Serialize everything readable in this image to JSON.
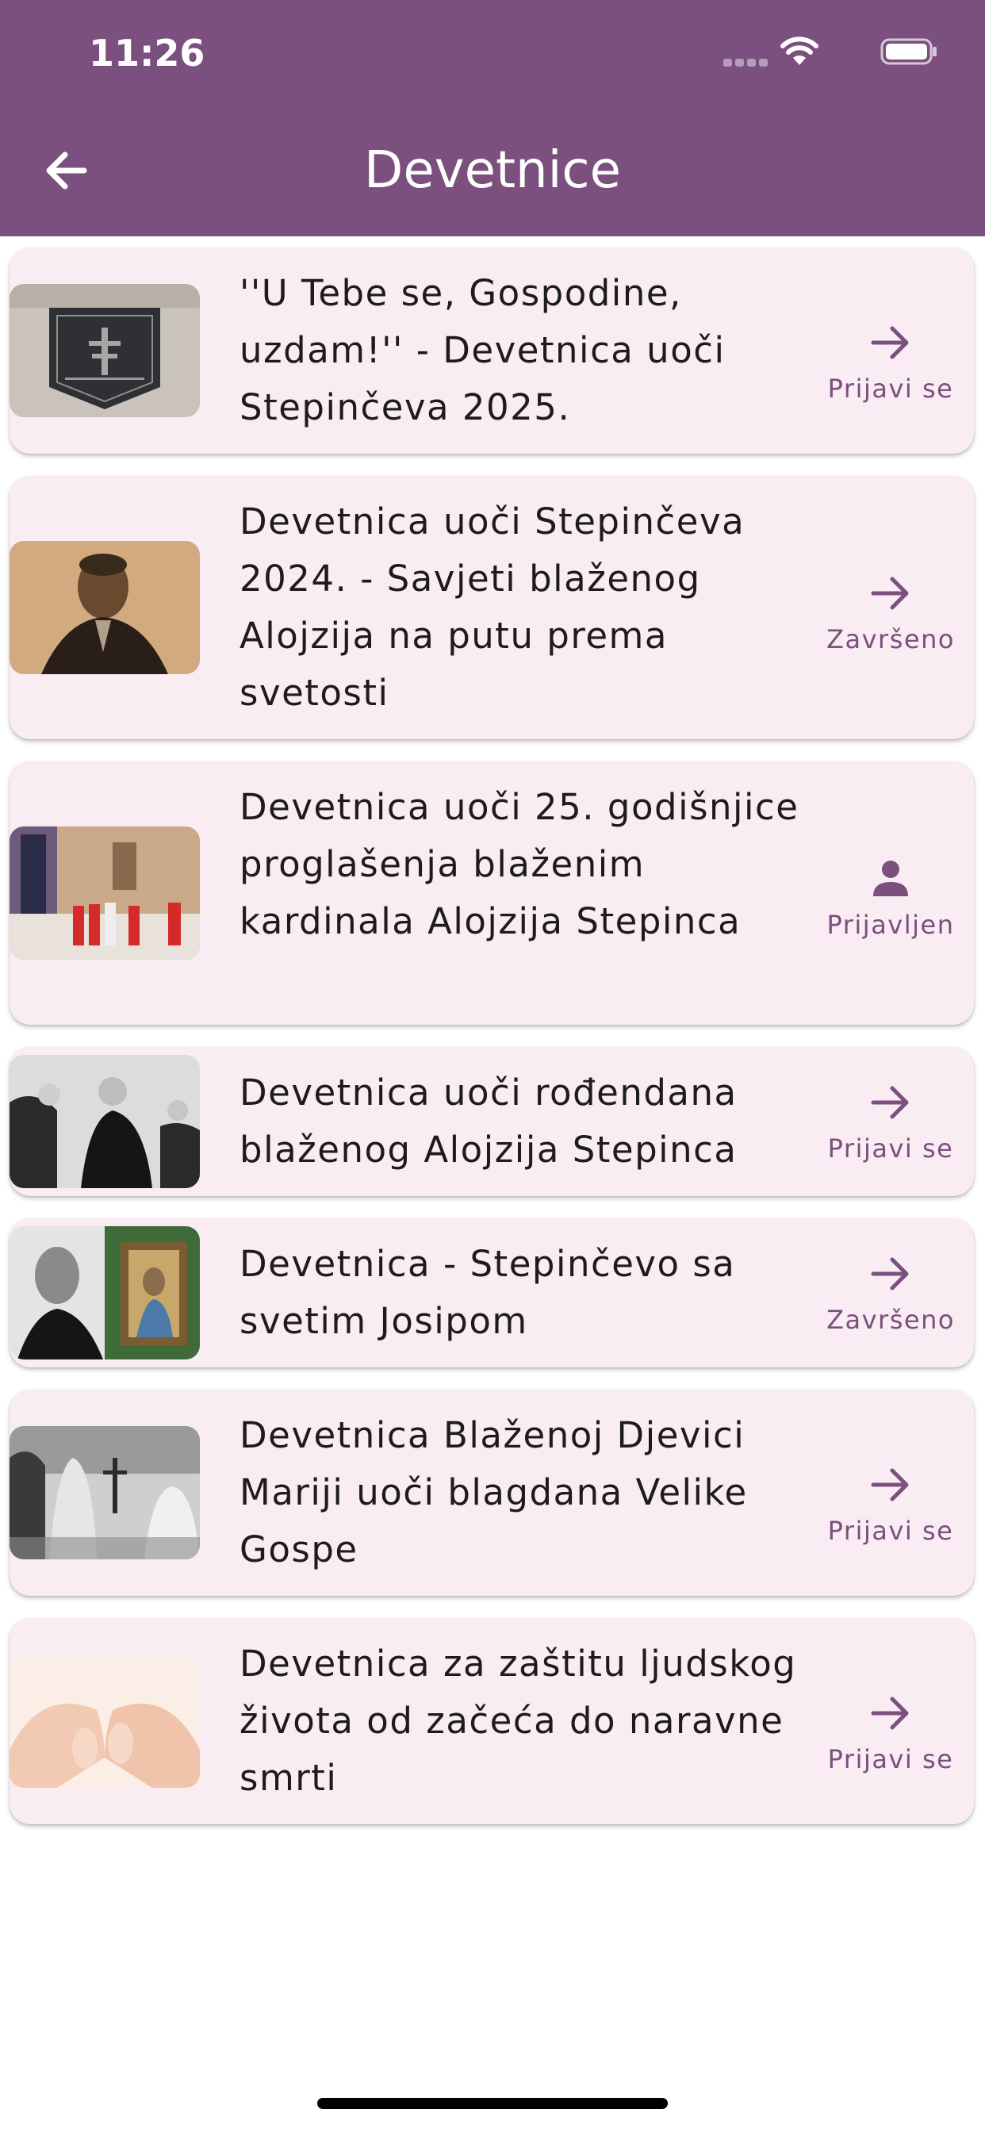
{
  "status_bar": {
    "time": "11:26"
  },
  "app_bar": {
    "title": "Devetnice",
    "back_icon": "arrow-left-icon"
  },
  "colors": {
    "primary": "#7b4f7e",
    "card_background": "#f9ecf3",
    "text": "#1d1b1e"
  },
  "novenas": [
    {
      "title": "''U Tebe se, Gospodine, uzdam!'' - Devetnica uoči Stepinčeva 2025.",
      "action_label": "Prijavi se",
      "action_icon": "arrow-right-icon"
    },
    {
      "title": "Devetnica uoči Stepinčeva 2024. - Savjeti blaženog Alojzija na putu prema svetosti",
      "action_label": "Završeno",
      "action_icon": "arrow-right-icon"
    },
    {
      "title": "Devetnica uoči 25. godišnjice proglašenja blaženim kardinala Alojzija Stepinca",
      "action_label": "Prijavljen",
      "action_icon": "person-icon"
    },
    {
      "title": "Devetnica uoči rođendana blaženog Alojzija Stepinca",
      "action_label": "Prijavi se",
      "action_icon": "arrow-right-icon"
    },
    {
      "title": "Devetnica - Stepinčevo sa svetim Josipom",
      "action_label": "Završeno",
      "action_icon": "arrow-right-icon"
    },
    {
      "title": "Devetnica Blaženoj Djevici Mariji uoči blagdana Velike Gospe",
      "action_label": "Prijavi se",
      "action_icon": "arrow-right-icon"
    },
    {
      "title": "Devetnica za zaštitu ljudskog života od začeća do naravne smrti",
      "action_label": "Prijavi se",
      "action_icon": "arrow-right-icon"
    }
  ]
}
